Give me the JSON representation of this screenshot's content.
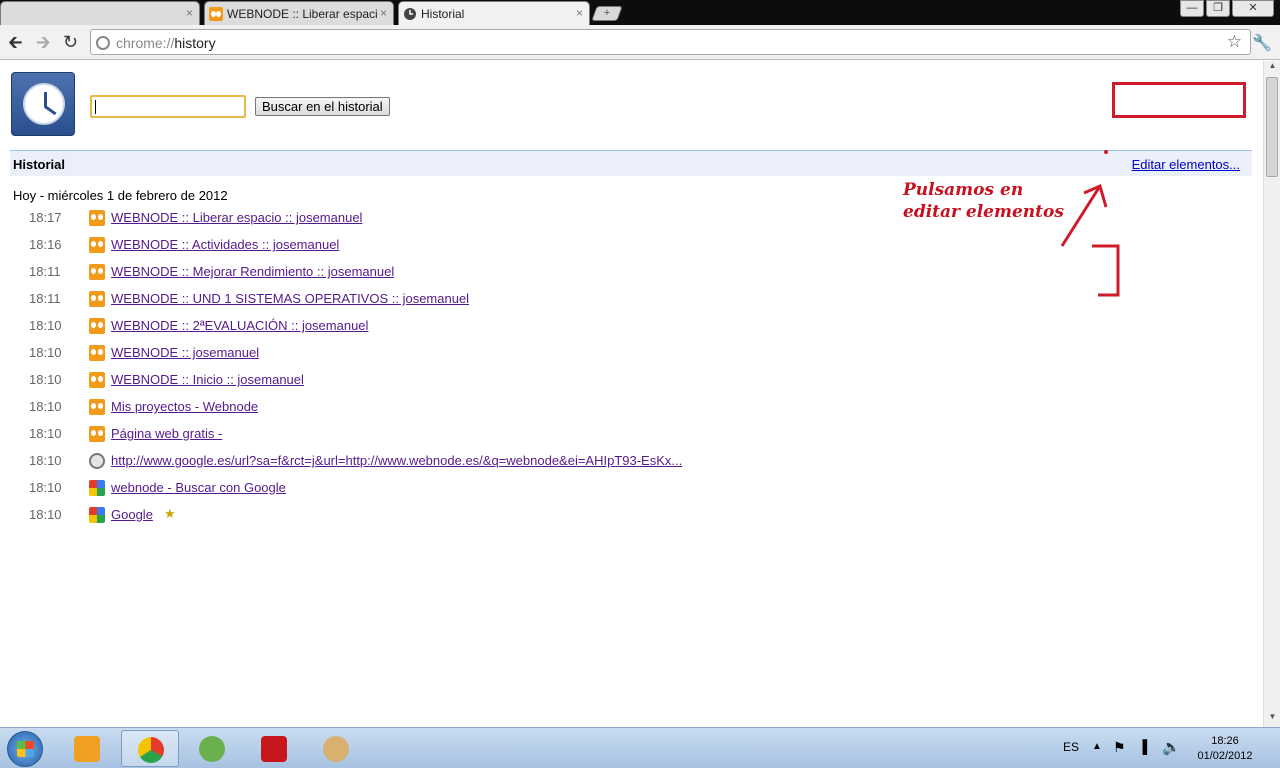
{
  "tabs": [
    {
      "title": "",
      "close": "×"
    },
    {
      "title": "WEBNODE :: Liberar espacio",
      "close": "×"
    },
    {
      "title": "Historial",
      "close": "×"
    }
  ],
  "new_tab_label": "+",
  "window_buttons": {
    "minimize": "—",
    "maximize": "❐",
    "close": "✕"
  },
  "omnibox": {
    "scheme": "chrome://",
    "path": "history"
  },
  "search": {
    "input_value": "",
    "button_label": "Buscar en el historial"
  },
  "section": {
    "title": "Historial",
    "edit_link": "Editar elementos..."
  },
  "day_header": "Hoy - miércoles 1 de febrero de 2012",
  "entries": [
    {
      "time": "18:17",
      "title": "WEBNODE :: Liberar espacio :: josemanuel",
      "icon": "webnode-icon"
    },
    {
      "time": "18:16",
      "title": "WEBNODE :: Actividades :: josemanuel",
      "icon": "webnode-icon"
    },
    {
      "time": "18:11",
      "title": "WEBNODE :: Mejorar Rendimiento :: josemanuel",
      "icon": "webnode-icon"
    },
    {
      "time": "18:11",
      "title": "WEBNODE :: UND 1 SISTEMAS OPERATIVOS :: josemanuel",
      "icon": "webnode-icon"
    },
    {
      "time": "18:10",
      "title": "WEBNODE :: 2ªEVALUACIÓN :: josemanuel",
      "icon": "webnode-icon"
    },
    {
      "time": "18:10",
      "title": "WEBNODE :: josemanuel",
      "icon": "webnode-icon"
    },
    {
      "time": "18:10",
      "title": "WEBNODE :: Inicio :: josemanuel",
      "icon": "webnode-icon"
    },
    {
      "time": "18:10",
      "title": "Mis proyectos - Webnode",
      "icon": "webnode-icon"
    },
    {
      "time": "18:10",
      "title": "Página web gratis -",
      "icon": "webnode-icon"
    },
    {
      "time": "18:10",
      "title": "http://www.google.es/url?sa=f&rct=j&url=http://www.webnode.es/&q=webnode&ei=AHIpT93-EsKx...",
      "icon": "globe-icon"
    },
    {
      "time": "18:10",
      "title": "webnode - Buscar con Google",
      "icon": "google-icon"
    },
    {
      "time": "18:10",
      "title": "Google",
      "icon": "google-icon",
      "starred": true
    }
  ],
  "annotation": {
    "line1": "Pulsamos en",
    "line2": "editar elementos",
    "color": "#c8101e"
  },
  "taskbar": {
    "language": "ES",
    "time": "18:26",
    "date": "01/02/2012"
  },
  "colors": {
    "link_visited": "#551a8b",
    "link": "#0000cc",
    "section_bg": "#ebeff9",
    "annotation_red": "#d01b2b"
  }
}
